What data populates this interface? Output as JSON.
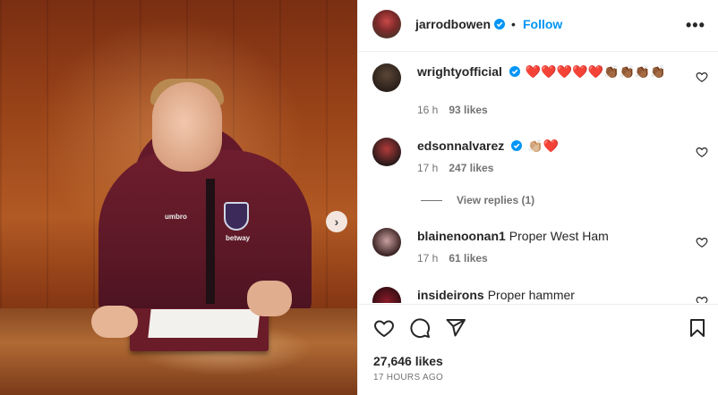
{
  "post": {
    "author": "jarrodbowen",
    "follow_label": "Follow",
    "separator": "•",
    "more_label": "•••",
    "likes": "27,646 likes",
    "time_ago": "17 HOURS AGO"
  },
  "photo": {
    "brand_left": "umbro",
    "brand_right": "betway",
    "next_label": "›"
  },
  "comments": [
    {
      "username": "wrightyofficial",
      "text": "❤️❤️❤️❤️❤️👏🏾👏🏾👏🏾👏🏾",
      "time": "16 h",
      "likes": "93 likes"
    },
    {
      "username": "edsonnalvarez",
      "text": "👏🏼❤️",
      "time": "17 h",
      "likes": "247 likes",
      "replies": "View replies (1)"
    },
    {
      "username": "blainenoonan1",
      "text": "Proper West Ham",
      "time": "17 h",
      "likes": "61 likes"
    },
    {
      "username": "insideirons",
      "text": "Proper hammer",
      "time": "",
      "likes": ""
    }
  ],
  "colors": {
    "link_blue": "#0095f6",
    "verified_blue": "#0095f6",
    "text": "#262626",
    "muted": "#737373"
  }
}
